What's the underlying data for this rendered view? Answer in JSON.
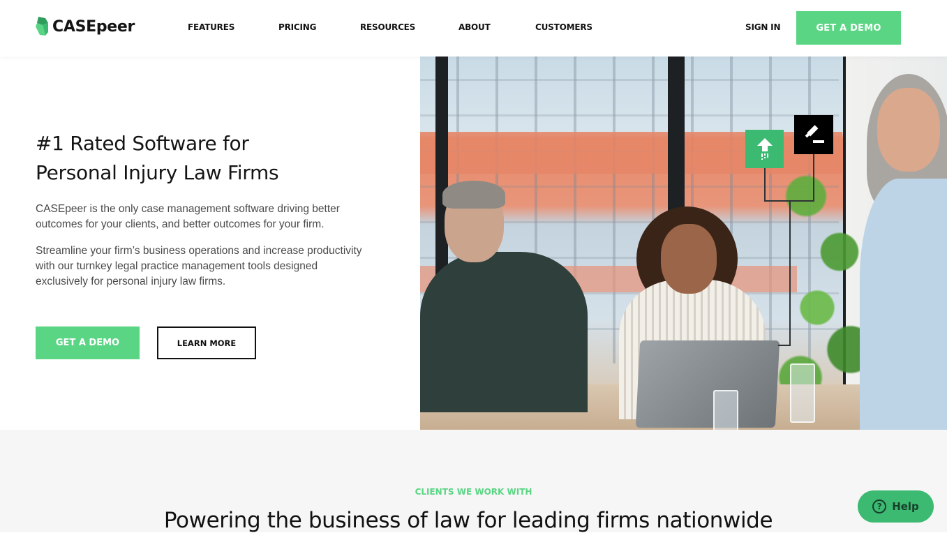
{
  "brand": {
    "name": "CASEpeer",
    "accent_color": "#5ad584",
    "help_color": "#3cba72"
  },
  "nav": {
    "items": [
      {
        "label": "FEATURES"
      },
      {
        "label": "PRICING"
      },
      {
        "label": "RESOURCES"
      },
      {
        "label": "ABOUT"
      },
      {
        "label": "CUSTOMERS"
      }
    ],
    "sign_in": "SIGN IN",
    "cta": "GET A DEMO"
  },
  "hero": {
    "title_line1": "#1 Rated Software for",
    "title_line2": "Personal Injury Law Firms",
    "paragraph1": "CASEpeer is the only case management software driving better outcomes for your clients, and better outcomes for your firm.",
    "paragraph2": "Streamline your firm’s business operations and increase productivity with our turnkey legal practice management tools designed exclusively for personal injury law firms.",
    "primary_button": "GET A DEMO",
    "secondary_button": "LEARN MORE",
    "image_alt": "Three professionals smiling in an office meeting with a laptop",
    "overlay_icons": [
      "upload-arrow-icon",
      "gavel-icon"
    ]
  },
  "clients": {
    "eyebrow": "CLIENTS WE WORK WITH",
    "title": "Powering the business of law for leading firms nationwide"
  },
  "help_widget": {
    "icon": "question-circle-icon",
    "label": "Help"
  }
}
